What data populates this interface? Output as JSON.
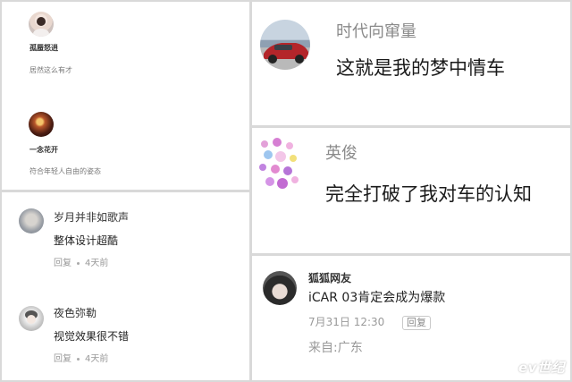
{
  "panel_left_top": {
    "comment1": {
      "username": "孤蜃怒逍",
      "text": "居然这么有才"
    },
    "comment2": {
      "username": "一念花开",
      "text": "符合年轻人自由的姿态"
    }
  },
  "panel_left_bottom": {
    "comment1": {
      "username": "岁月并非如歌声",
      "text": "整体设计超酷",
      "reply_label": "回复",
      "time": "4天前"
    },
    "comment2": {
      "username": "夜色弥勒",
      "text": "视觉效果很不错",
      "reply_label": "回复",
      "time": "4天前"
    }
  },
  "panel_right_1": {
    "username": "时代向窜量",
    "text": "这就是我的梦中情车"
  },
  "panel_right_2": {
    "username": "英俊",
    "text": "完全打破了我对车的认知"
  },
  "panel_right_3": {
    "username": "狐狐网友",
    "text": "iCAR 03肯定会成为爆款",
    "date": "7月31日 12:30",
    "reply_label": "回复",
    "location": "来自:广东"
  },
  "watermark": "ev世纪",
  "colors": {
    "background": "#d9d9d9",
    "card": "#ffffff",
    "muted_text": "#999999",
    "username_gray": "#8a8a8a"
  }
}
